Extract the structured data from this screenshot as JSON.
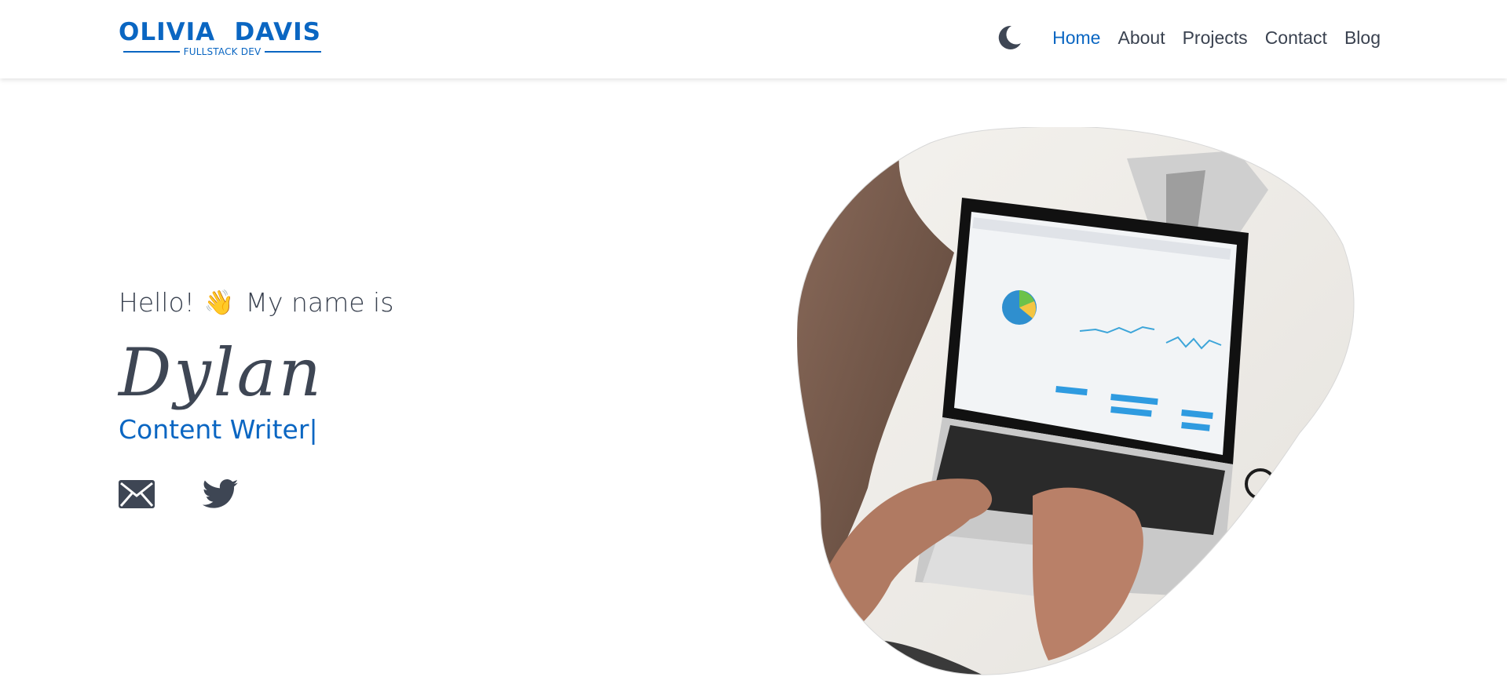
{
  "logo": {
    "first_name": "OLIVIA",
    "last_name": "DAVIS",
    "tagline": "FULLSTACK DEV"
  },
  "nav": {
    "theme_icon": "moon-icon",
    "links": [
      {
        "label": "Home",
        "active": true
      },
      {
        "label": "About",
        "active": false
      },
      {
        "label": "Projects",
        "active": false
      },
      {
        "label": "Contact",
        "active": false
      },
      {
        "label": "Blog",
        "active": false
      }
    ]
  },
  "hero": {
    "greeting_before": "Hello!",
    "greeting_emoji": "👋",
    "greeting_after": "My name is",
    "name": "Dylan",
    "role": "Content Writer",
    "cursor": "|",
    "social": [
      {
        "icon": "envelope-icon"
      },
      {
        "icon": "twitter-icon"
      }
    ],
    "image_icon": "laptop-photo"
  },
  "colors": {
    "accent": "#0a66c2",
    "text": "#3a4250"
  }
}
